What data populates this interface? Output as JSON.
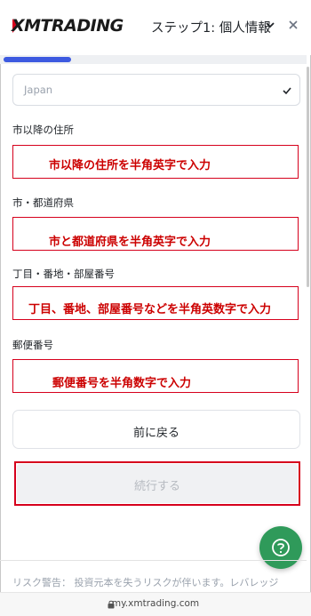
{
  "header": {
    "logo_text": "XMTRADING",
    "step_title": "ステップ1: 個人情報",
    "progress_fraction": 0.22
  },
  "country_field": {
    "value": "Japan"
  },
  "fields": [
    {
      "label": "市以降の住所",
      "hint": "市以降の住所を半角英字で入力"
    },
    {
      "label": "市・都道府県",
      "hint": "市と都道府県を半角英字で入力"
    },
    {
      "label": "丁目・番地・部屋番号",
      "hint": "丁目、番地、部屋番号などを半角英数字で入力"
    },
    {
      "label": "郵便番号",
      "hint": "郵便番号を半角数字で入力"
    }
  ],
  "buttons": {
    "back_label": "前に戻る",
    "continue_label": "続行する"
  },
  "footer": {
    "risk_text": "リスク警告： 投資元本を失うリスクが伴います。レバレッジ",
    "url": "my.xmtrading.com"
  },
  "colors": {
    "accent": "#3d5ae0",
    "annotation_red": "#d6001c",
    "help_green": "#2f9a5a"
  },
  "icons": {
    "chevron": "chevron-down-icon",
    "close": "close-icon",
    "check": "check-icon",
    "help": "help-icon",
    "lock": "lock-icon"
  }
}
